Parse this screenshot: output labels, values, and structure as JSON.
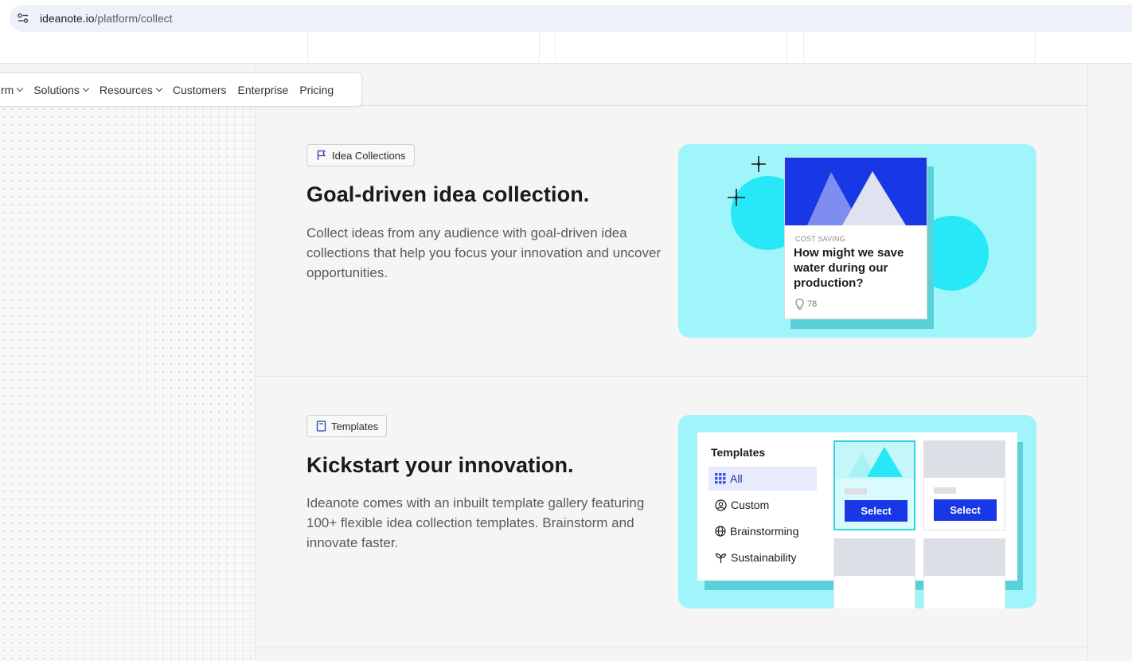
{
  "browser": {
    "url_host": "ideanote.io",
    "url_path": "/platform/collect"
  },
  "nav": {
    "items": [
      {
        "label": "rm",
        "has_dropdown": true
      },
      {
        "label": "Solutions",
        "has_dropdown": true
      },
      {
        "label": "Resources",
        "has_dropdown": true
      },
      {
        "label": "Customers",
        "has_dropdown": false
      },
      {
        "label": "Enterprise",
        "has_dropdown": false
      },
      {
        "label": "Pricing",
        "has_dropdown": false
      }
    ]
  },
  "sections": {
    "collections": {
      "tag": "Idea Collections",
      "tag_icon": "flag-icon",
      "heading": "Goal-driven idea collection.",
      "body": "Collect ideas from any audience with goal-driven idea collections that help you focus your innovation and uncover opportunities.",
      "card": {
        "category": "COST SAVING",
        "question": "How might we save water during our production?",
        "votes": "78"
      }
    },
    "templates": {
      "tag": "Templates",
      "tag_icon": "document-icon",
      "heading": "Kickstart your innovation.",
      "body": "Ideanote comes with an inbuilt template gallery featuring 100+ flexible idea collection templates. Brainstorm and innovate faster.",
      "panel": {
        "title": "Templates",
        "categories": [
          {
            "label": "All",
            "icon": "grid-icon",
            "active": true
          },
          {
            "label": "Custom",
            "icon": "user-circle-icon",
            "active": false
          },
          {
            "label": "Brainstorming",
            "icon": "globe-icon",
            "active": false
          },
          {
            "label": "Sustainability",
            "icon": "plant-icon",
            "active": false
          }
        ],
        "select_label": "Select"
      }
    }
  },
  "colors": {
    "brand_blue": "#1838e6",
    "cyan_light": "#9ff5fa",
    "cyan": "#27e8f7"
  }
}
